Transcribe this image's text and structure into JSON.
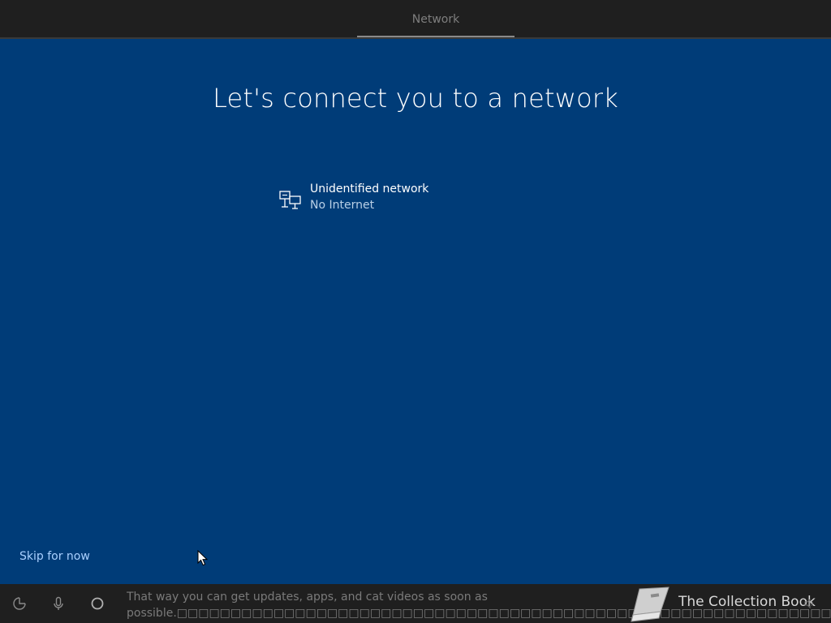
{
  "header": {
    "tab_label": "Network"
  },
  "main": {
    "title": "Let's connect you to a network",
    "networks": [
      {
        "name": "Unidentified network",
        "status": "No Internet",
        "icon": "wired-network-icon"
      }
    ]
  },
  "footer": {
    "skip_label": "Skip for now"
  },
  "taskbar": {
    "icons": [
      "ease-of-access-icon",
      "microphone-icon",
      "cortana-icon"
    ],
    "caption_line1": "That way you can get updates, apps, and cat videos as soon as",
    "caption_line2": "possible.□□□□□□□□□□□□□□□□□□□□□□□□□□□□□□□□□□□□□□□□□□□□□□□□□□□□□□□□□□□□□□□□□□□□□□□□□□"
  },
  "watermark": {
    "text": "The Collection Book"
  },
  "colors": {
    "background": "#003c78",
    "bar": "#1f1f1f",
    "link": "#a9d0ff"
  }
}
